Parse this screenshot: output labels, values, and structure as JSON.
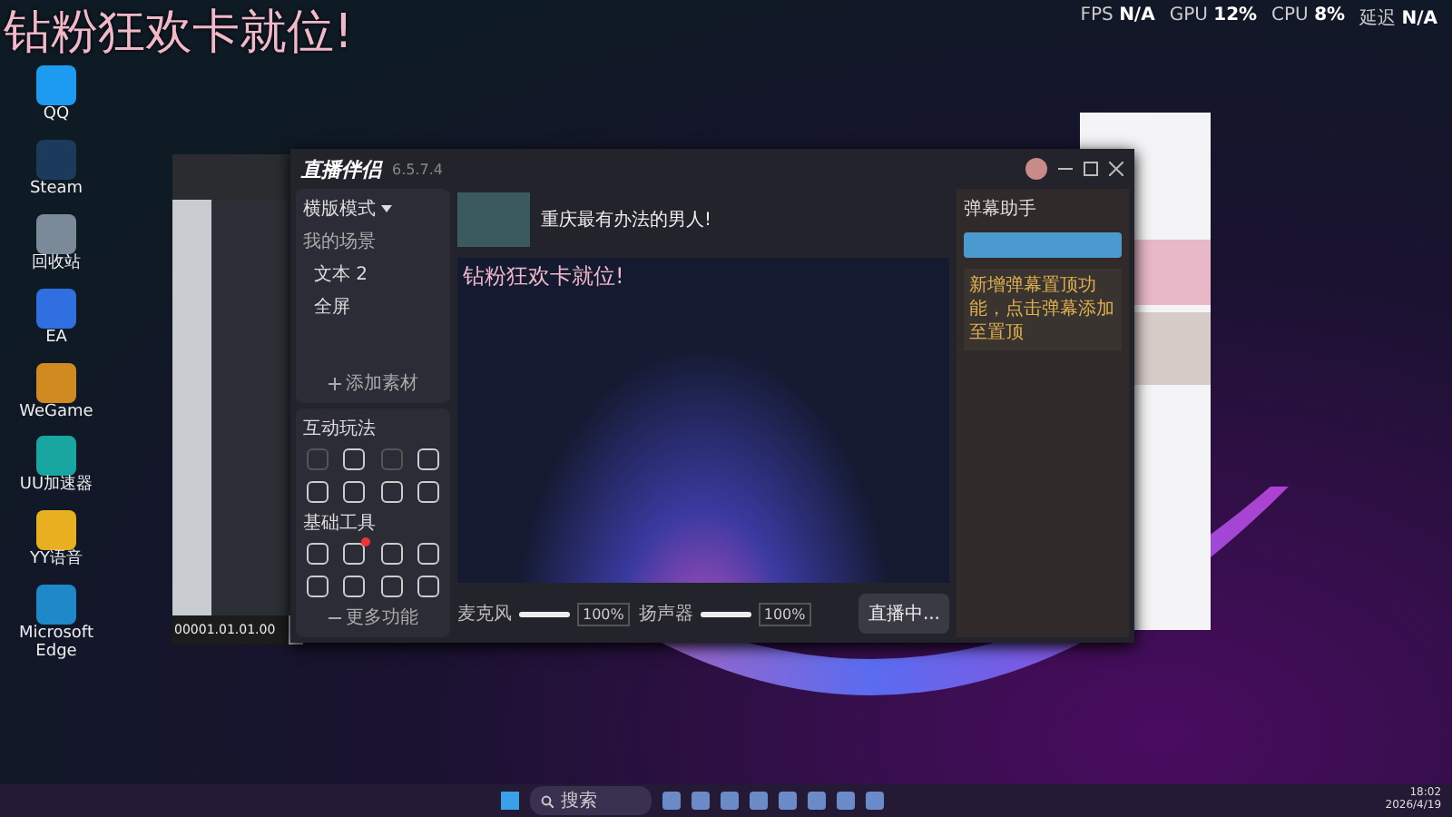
{
  "overlay_text": "钻粉狂欢卡就位!",
  "perf": [
    {
      "label": "FPS",
      "value": "N/A"
    },
    {
      "label": "GPU",
      "value": "12%"
    },
    {
      "label": "CPU",
      "value": "8%"
    },
    {
      "label": "延迟",
      "value": "N/A"
    }
  ],
  "desktop_icons": [
    {
      "label": "QQ",
      "color": "#1d9bf0"
    },
    {
      "label": "Steam",
      "color": "#1b3a5c"
    },
    {
      "label": "回收站",
      "color": "#7a8a99"
    },
    {
      "label": "EA",
      "color": "#2f6fe0"
    },
    {
      "label": "WeGame",
      "color": "#d08a20"
    },
    {
      "label": "UU加速器",
      "color": "#1aa6a0"
    },
    {
      "label": "YY语音",
      "color": "#e8b020"
    },
    {
      "label": "Microsoft Edge",
      "color": "#1e88c8"
    }
  ],
  "daw": {
    "timecode": "00001.01.01.00"
  },
  "app": {
    "title": "直播伴侣",
    "version": "6.5.7.4",
    "mode": "横版模式",
    "scenes_label": "我的场景",
    "sources": [
      {
        "name": "文本 2",
        "visible": true
      },
      {
        "name": "全屏",
        "visible": true
      }
    ],
    "add_source": "添加素材",
    "interactive_title": "互动玩法",
    "interactive_tools": [
      {
        "disabled": true
      },
      {
        "disabled": false
      },
      {
        "disabled": true
      },
      {
        "disabled": false
      },
      {
        "disabled": false
      },
      {
        "disabled": false
      },
      {
        "disabled": false
      },
      {
        "disabled": false
      }
    ],
    "tools_title": "基础工具",
    "tools": [
      {
        "badge": false
      },
      {
        "badge": true
      },
      {
        "badge": false
      },
      {
        "badge": false
      },
      {
        "badge": false
      },
      {
        "badge": false
      },
      {
        "badge": false
      },
      {
        "badge": false
      }
    ],
    "more": "更多功能",
    "stream_title": "重庆最有办法的男人!",
    "preview_overlay": "钻粉狂欢卡就位!",
    "audio": [
      {
        "label": "麦克风",
        "level": 1,
        "reading": "100%"
      },
      {
        "label": "扬声器",
        "level": 1,
        "reading": "100%"
      }
    ],
    "live_button": "直播中...",
    "chat_title": "弹幕助手",
    "notice": "新增弹幕置顶功能，点击弹幕添加至置顶"
  },
  "taskbar": {
    "search": "搜索",
    "time": "18:02",
    "date": "2026/4/19"
  }
}
